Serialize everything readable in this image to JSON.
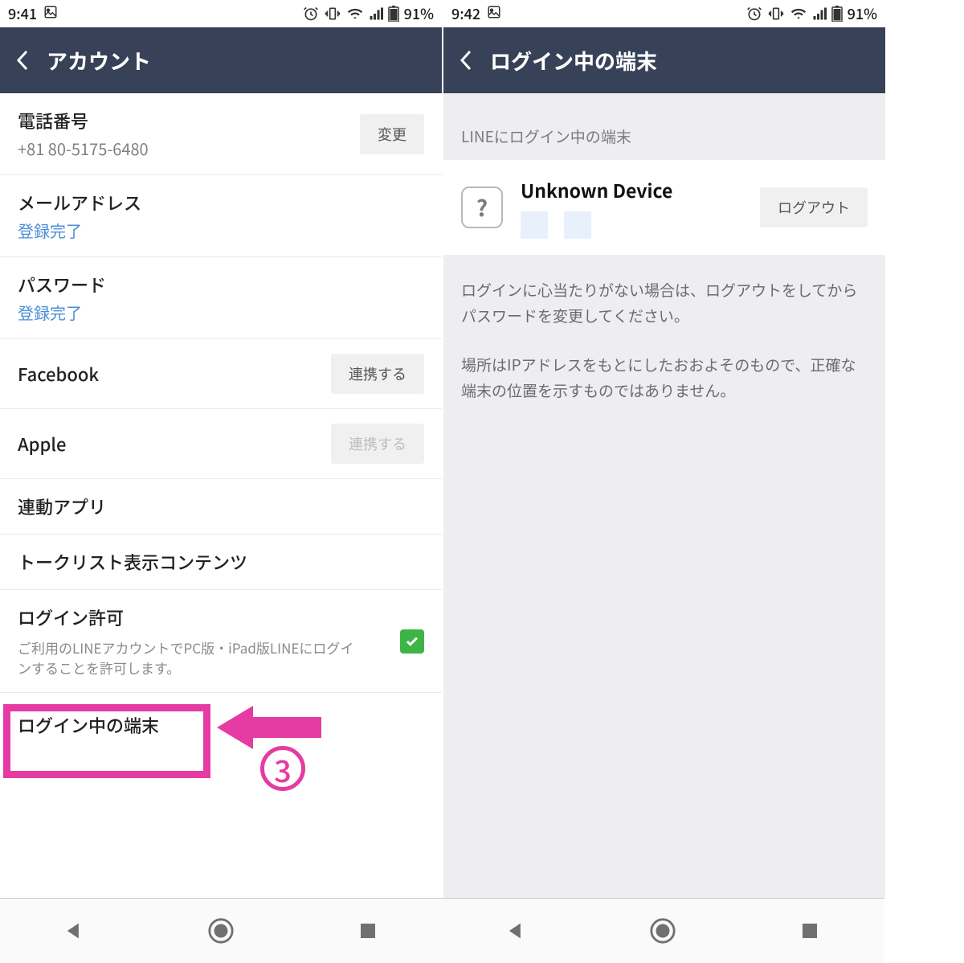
{
  "left": {
    "status": {
      "time": "9:41",
      "battery": "91%"
    },
    "header": {
      "title": "アカウント"
    },
    "rows": {
      "phone": {
        "label": "電話番号",
        "value": "+81 80-5175-6480",
        "button": "変更"
      },
      "email": {
        "label": "メールアドレス",
        "status": "登録完了"
      },
      "password": {
        "label": "パスワード",
        "status": "登録完了"
      },
      "facebook": {
        "label": "Facebook",
        "button": "連携する"
      },
      "apple": {
        "label": "Apple",
        "button": "連携する"
      },
      "linked_apps": {
        "label": "連動アプリ"
      },
      "talk_list": {
        "label": "トークリスト表示コンテンツ"
      },
      "login_permission": {
        "label": "ログイン許可",
        "desc": "ご利用のLINEアカウントでPC版・iPad版LINEにログインすることを許可します。"
      },
      "logged_in_devices": {
        "label": "ログイン中の端末"
      }
    },
    "annotation": {
      "number": "3"
    }
  },
  "right": {
    "status": {
      "time": "9:42",
      "battery": "91%"
    },
    "header": {
      "title": "ログイン中の端末"
    },
    "section_header": "LINEにログイン中の端末",
    "device": {
      "name": "Unknown Device",
      "icon": "?",
      "logout": "ログアウト"
    },
    "note1": "ログインに心当たりがない場合は、ログアウトをしてからパスワードを変更してください。",
    "note2": "場所はIPアドレスをもとにしたおおよそのもので、正確な端末の位置を示すものではありません。"
  }
}
